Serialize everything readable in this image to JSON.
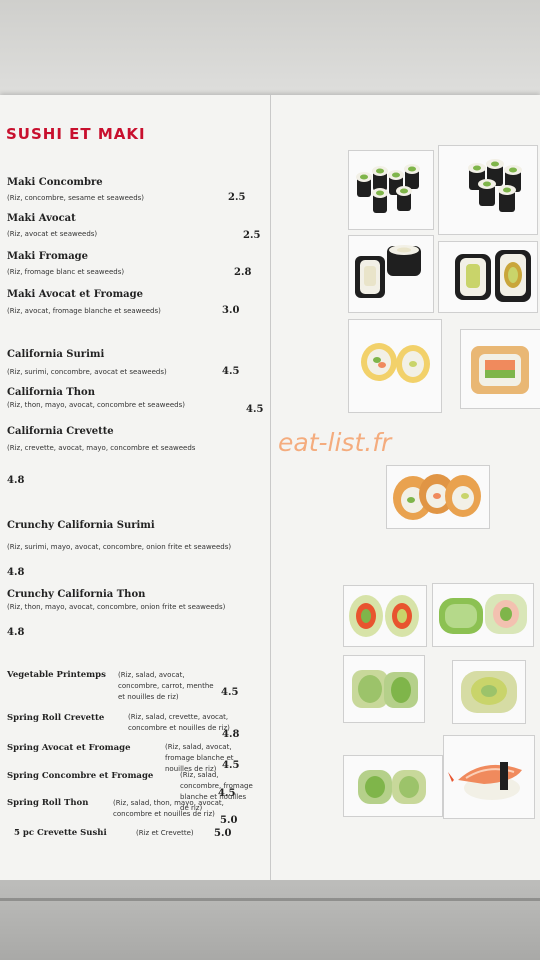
{
  "menu": {
    "title": "SUSHI ET MAKI",
    "watermark": "eat-list.fr",
    "items": [
      {
        "name": "Maki Concombre",
        "desc": "(Riz, concombre, sesame et seaweeds)",
        "price": "2.5"
      },
      {
        "name": "Maki Avocat",
        "desc": "(Riz, avocat et seaweeds)",
        "price": "2.5"
      },
      {
        "name": "Maki Fromage",
        "desc": "(Riz, fromage blanc et seaweeds)",
        "price": "2.8"
      },
      {
        "name": "Maki Avocat et Fromage",
        "desc": "(Riz, avocat, fromage blanche et seaweeds)",
        "price": "3.0"
      },
      {
        "name": "California Surimi",
        "desc": "(Riz, surimi, concombre, avocat et seaweeds)",
        "price": "4.5"
      },
      {
        "name": "California Thon",
        "desc": "(Riz, thon, mayo, avocat, concombre et seaweeds)",
        "price": "4.5"
      },
      {
        "name": "California Crevette",
        "desc": "(Riz, crevette, avocat, mayo, concombre et seaweeds",
        "price": "4.8"
      },
      {
        "name": "Crunchy California Surimi",
        "desc": "(Riz, surimi, mayo, avocat, concombre, onion frite et seaweeds)",
        "price": "4.8"
      },
      {
        "name": "Crunchy California Thon",
        "desc": "(Riz, thon, mayo, avocat, concombre, onion frite et seaweeds)",
        "price": "4.8"
      },
      {
        "name": "Vegetable Printemps",
        "desc": "(Riz, salad, avocat, concombre, carrot, menthe et nouilles de riz)",
        "price": "4.5"
      },
      {
        "name": "Spring Roll Crevette",
        "desc": "(Riz, salad, crevette, avocat, concombre et nouilles de riz)",
        "price": "4.8"
      },
      {
        "name": "Spring Avocat et Fromage",
        "desc": "(Riz, salad, avocat, fromage blanche et nouilles de riz)",
        "price": "4.5"
      },
      {
        "name": "Spring Concombre et Fromage",
        "desc": "(Riz, salad, concombre, fromage blanche et nouilles de riz)",
        "price": "4.5"
      },
      {
        "name": "Spring Roll Thon",
        "desc": "(Riz, salad, thon, mayo, avocat, concombre et nouilles de riz)",
        "price": "5.0"
      },
      {
        "name": "5 pc Crevette Sushi",
        "desc": "(Riz et Crevette)",
        "price": "5.0"
      }
    ]
  },
  "colors": {
    "title": "#c8102e",
    "watermark": "#f5a06a",
    "nori": "#1f1f1f",
    "rice": "#f2f0e6",
    "cucumber": "#7fb54a",
    "avocado": "#c9d46a",
    "salmon": "#f08a5d"
  },
  "photos": [
    {
      "icon": "maki-cucumber-icon"
    },
    {
      "icon": "maki-cucumber-icon"
    },
    {
      "icon": "maki-cheese-icon"
    },
    {
      "icon": "maki-avocado-cheese-icon"
    },
    {
      "icon": "california-roll-icon"
    },
    {
      "icon": "california-salmon-roll-icon"
    },
    {
      "icon": "crunchy-roll-icon"
    },
    {
      "icon": "spring-roll-icon"
    },
    {
      "icon": "spring-roll-icon"
    },
    {
      "icon": "vegetable-roll-icon"
    },
    {
      "icon": "vegetable-roll-icon"
    },
    {
      "icon": "spring-roll-icon"
    },
    {
      "icon": "shrimp-sushi-icon"
    }
  ]
}
